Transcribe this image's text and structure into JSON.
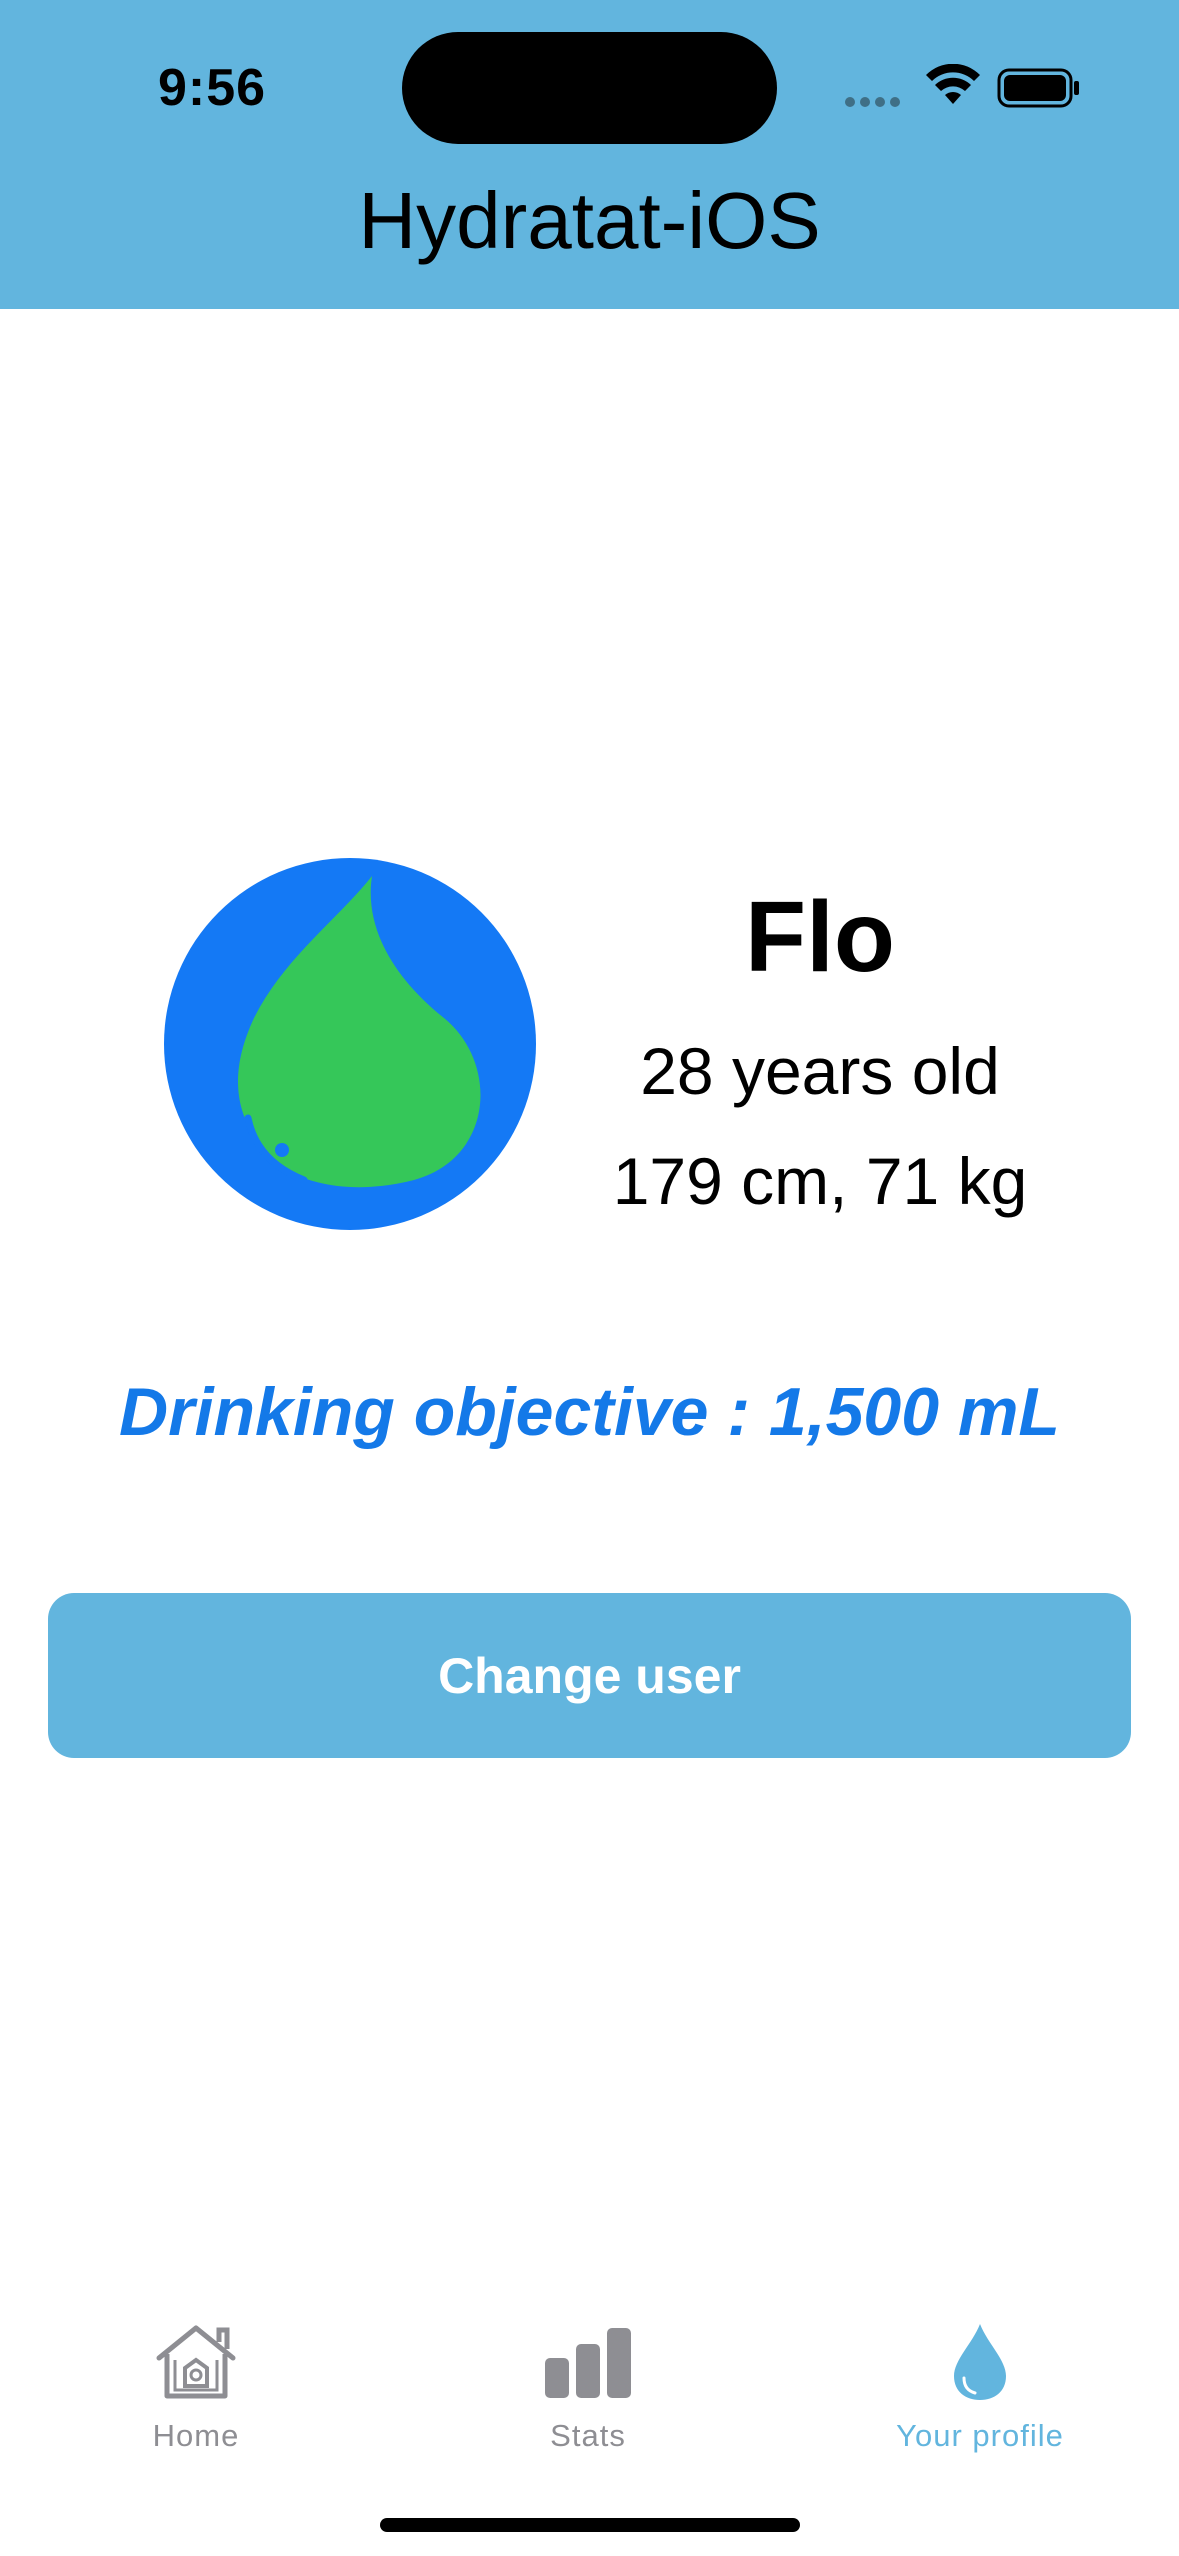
{
  "status_bar": {
    "time": "9:56"
  },
  "header": {
    "title": "Hydratat-iOS",
    "background": "#62b5de"
  },
  "profile": {
    "name": "Flo",
    "age_text": "28 years old",
    "measurements_text": "179 cm, 71 kg",
    "objective_text": "Drinking objective : 1,500 mL",
    "objective_color": "#1479e8",
    "avatar_icon": "water-drop-avatar-icon"
  },
  "actions": {
    "change_user_label": "Change user"
  },
  "tab_bar": {
    "active_color": "#62b5de",
    "inactive_color": "#8e8e93",
    "tabs": [
      {
        "label": "Home",
        "icon": "house-icon",
        "active": false
      },
      {
        "label": "Stats",
        "icon": "bar-chart-icon",
        "active": false
      },
      {
        "label": "Your profile",
        "icon": "water-drop-icon",
        "active": true
      }
    ]
  }
}
